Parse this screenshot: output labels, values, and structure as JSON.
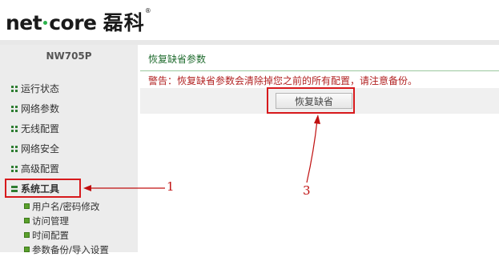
{
  "brand": {
    "logo_left": "net",
    "logo_right": "core",
    "logo_cn": "磊科",
    "logo_reg": "®"
  },
  "sidebar": {
    "model": "NW705P",
    "items": [
      {
        "label": "运行状态"
      },
      {
        "label": "网络参数"
      },
      {
        "label": "无线配置"
      },
      {
        "label": "网络安全"
      },
      {
        "label": "高级配置"
      },
      {
        "label": "系统工具"
      }
    ],
    "subitems": [
      {
        "label": "用户名/密码修改"
      },
      {
        "label": "访问管理"
      },
      {
        "label": "时间配置"
      },
      {
        "label": "参数备份/导入设置"
      }
    ]
  },
  "main": {
    "section_title": "恢复缺省参数",
    "warning": "警告：恢复缺省参数会清除掉您之前的所有配置，请注意备份。",
    "restore_button": "恢复缺省"
  },
  "annotations": {
    "label1": "1",
    "label3": "3"
  },
  "colors": {
    "accent_green": "#1f6b2e",
    "warning_red": "#b22222",
    "highlight_red": "#d7191c"
  }
}
